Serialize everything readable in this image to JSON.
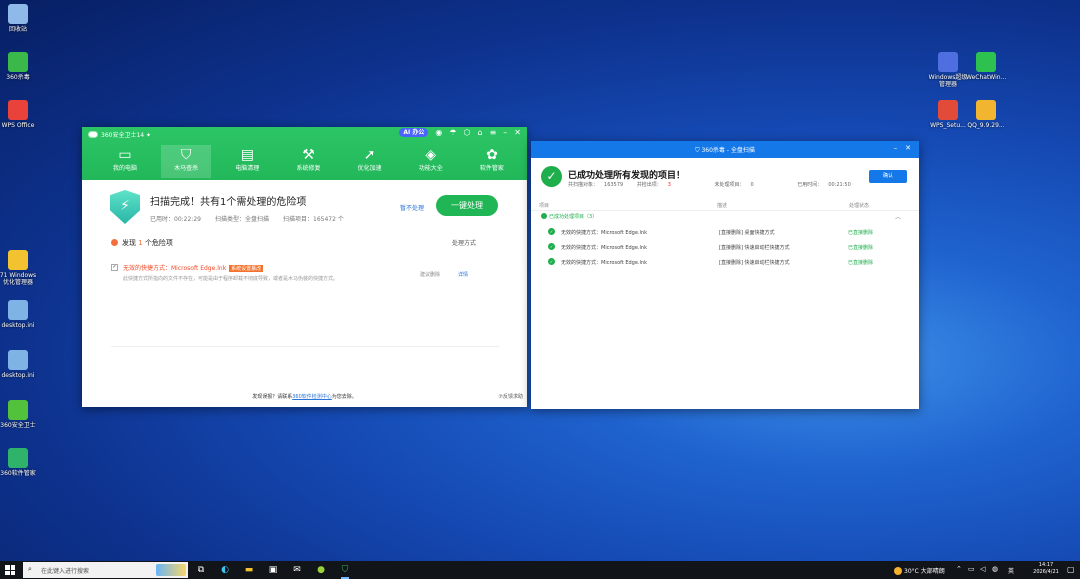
{
  "desktop": {
    "left_icons": [
      {
        "label": "回收站",
        "color": "#8fb9e8"
      },
      {
        "label": "360杀毒",
        "color": "#3bb84a"
      },
      {
        "label": "WPS Office",
        "color": "#e8423a"
      },
      {
        "label": "71 Windows 优化管理器",
        "color": "#f2c230"
      },
      {
        "label": "desktop.ini",
        "color": "#7fb2e5"
      },
      {
        "label": "desktop.ini",
        "color": "#7fb2e5"
      },
      {
        "label": "360安全卫士",
        "color": "#52c23c"
      },
      {
        "label": "360软件管家",
        "color": "#2fb36a"
      }
    ],
    "right_icons": [
      {
        "label": "Windows超级管理器",
        "color": "#4f6ee0"
      },
      {
        "label": "WeChatWin...",
        "color": "#2dc14f"
      },
      {
        "label": "WPS_Setu...",
        "color": "#e24a3a"
      },
      {
        "label": "QQ_9.9.29...",
        "color": "#f2b530"
      }
    ]
  },
  "main_window": {
    "title": "360安全卫士14 ✦",
    "ai_badge": "AI 办公",
    "nav": [
      {
        "label": "我的电脑",
        "icon": "▭"
      },
      {
        "label": "木马查杀",
        "icon": "⛉"
      },
      {
        "label": "电脑清理",
        "icon": "▤"
      },
      {
        "label": "系统修复",
        "icon": "⚒"
      },
      {
        "label": "优化加速",
        "icon": "➚"
      },
      {
        "label": "功能大全",
        "icon": "◈"
      },
      {
        "label": "软件管家",
        "icon": "✿"
      }
    ],
    "scan_title": "扫描完成！共有1个需处理的危险项",
    "elapsed_label": "已用时：",
    "elapsed": "00:22:29",
    "scan_type_label": "扫描类型：",
    "scan_type": "全盘扫描",
    "scanned_label": "扫描项目：",
    "scanned": "165472 个",
    "ignore": "暂不处理",
    "fix_all": "一键处理",
    "found_prefix": "发现",
    "found_count": "1",
    "found_suffix": "个危险项",
    "action_col": "处理方式",
    "item": {
      "checkbox": "✓",
      "name": "无效的快捷方式：Microsoft Edge.lnk",
      "badge": "系统设置篡改",
      "desc": "此快捷方式所指向的文件不存在，可能是由于程序卸载不彻底导致，或者是木马伪装的快捷方式。",
      "action": "建议删除",
      "detail": "详情"
    },
    "footer_prefix": "发现误报？请联系",
    "footer_link": "360软件检测中心",
    "footer_suffix": "为您去除。",
    "feedback": "⑦反馈求助"
  },
  "result_window": {
    "title": "360杀毒 - 全盘扫描",
    "heading": "已成功处理所有发现的项目！",
    "stats": {
      "scanned_label": "共扫描对象：",
      "scanned": "163579",
      "threats_label": "共检出项：",
      "threats": "3",
      "unprocessed_label": "未处理项目：",
      "unprocessed": "0",
      "time_label": "已用时间：",
      "time": "00:21:50"
    },
    "confirm": "确认",
    "columns": {
      "item": "项目",
      "desc": "描述",
      "status": "处理状态"
    },
    "group_label": "已成功处理项目（3）",
    "rows": [
      {
        "name": "无效的快捷方式：Microsoft Edge.lnk",
        "method": "[直接删除] 桌面快捷方式",
        "status": "已直接删除"
      },
      {
        "name": "无效的快捷方式：Microsoft Edge.lnk",
        "method": "[直接删除] 快速启动栏快捷方式",
        "status": "已直接删除"
      },
      {
        "name": "无效的快捷方式：Microsoft Edge.lnk",
        "method": "[直接删除] 快速启动栏快捷方式",
        "status": "已直接删除"
      }
    ]
  },
  "taskbar": {
    "search_placeholder": "在此键入进行搜索",
    "weather": "30°C 大部晴朗",
    "ime": "英",
    "time": "14:17",
    "date": "2026/4/21"
  }
}
